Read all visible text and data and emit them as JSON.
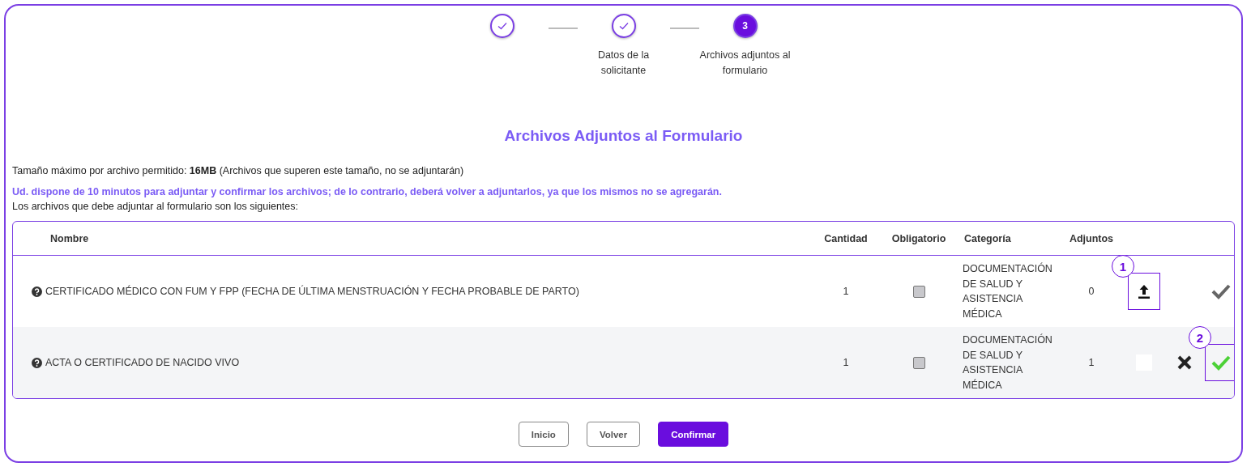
{
  "steps": [
    {
      "done": true,
      "current": false
    },
    {
      "done": true,
      "current": false,
      "label": "Datos de la solicitante"
    },
    {
      "number": "3",
      "done": false,
      "current": true,
      "label": "Archivos adjuntos al formulario"
    }
  ],
  "title": "Archivos Adjuntos al Formulario",
  "notes": [
    {
      "kind": "info",
      "text": "Tamaño máximo por archivo permitido: **16MB** (Archivos que superen este tamaño, no se adjuntarán)"
    },
    {
      "kind": "warning",
      "text": "Ud. dispone de 10 minutos para adjuntar y confirmar los archivos; de lo contrario, deberá volver a adjuntarlos, ya que los mismos no se agregarán."
    },
    {
      "kind": "info",
      "text": "Los archivos que debe adjuntar al formulario son los siguientes:"
    }
  ],
  "table": {
    "columns": [
      "Nombre",
      "Cantidad",
      "Obligatorio",
      "Categoría",
      "Adjuntos"
    ],
    "rows": [
      {
        "name": "CERTIFICADO MÉDICO CON FUM Y FPP (FECHA DE ÚLTIMA MENSTRUACIÓN Y FECHA PROBABLE DE PARTO)",
        "quantity": "1",
        "required": {
          "checked": false,
          "disabled": true
        },
        "category": "DOCUMENTACIÓN DE SALUD Y ASISTENCIA MÉDICA",
        "attachments": "0",
        "actions": [
          {
            "kind": "upload",
            "callout": "1"
          },
          {
            "kind": "none"
          },
          {
            "kind": "confirm",
            "done": false
          }
        ]
      },
      {
        "name": "ACTA O CERTIFICADO DE NACIDO VIVO",
        "quantity": "1",
        "required": {
          "checked": false,
          "disabled": true
        },
        "category": "DOCUMENTACIÓN DE SALUD Y ASISTENCIA MÉDICA",
        "attachments": "1",
        "actions": [
          {
            "kind": "blank"
          },
          {
            "kind": "delete"
          },
          {
            "kind": "confirm",
            "done": true,
            "callout": "2"
          }
        ]
      }
    ]
  },
  "buttons": [
    {
      "label": "Inicio",
      "primary": false
    },
    {
      "label": "Volver",
      "primary": false
    },
    {
      "label": "Confirmar",
      "primary": true
    }
  ]
}
